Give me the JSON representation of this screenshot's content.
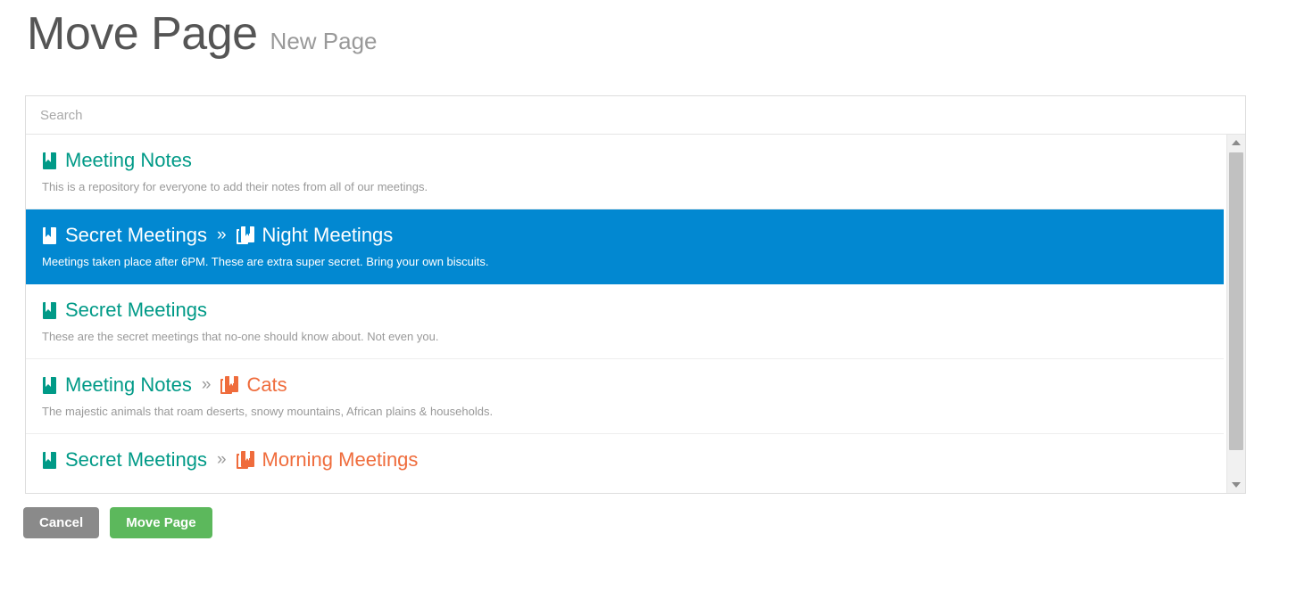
{
  "header": {
    "title": "Move Page",
    "subtitle": "New Page"
  },
  "search": {
    "placeholder": "Search",
    "value": ""
  },
  "results": [
    {
      "crumbs": [
        {
          "icon": "book-icon",
          "label": "Meeting Notes",
          "kind": "book"
        }
      ],
      "description": "This is a repository for everyone to add their notes from all of our meetings.",
      "selected": false
    },
    {
      "crumbs": [
        {
          "icon": "book-icon",
          "label": "Secret Meetings",
          "kind": "book"
        },
        {
          "icon": "page-icon",
          "label": "Night Meetings",
          "kind": "page"
        }
      ],
      "description": "Meetings taken place after 6PM. These are extra super secret. Bring your own biscuits.",
      "selected": true
    },
    {
      "crumbs": [
        {
          "icon": "book-icon",
          "label": "Secret Meetings",
          "kind": "book"
        }
      ],
      "description": "These are the secret meetings that no-one should know about. Not even you.",
      "selected": false
    },
    {
      "crumbs": [
        {
          "icon": "book-icon",
          "label": "Meeting Notes",
          "kind": "book"
        },
        {
          "icon": "page-icon",
          "label": "Cats",
          "kind": "page"
        }
      ],
      "description": "The majestic animals that roam deserts, snowy mountains, African plains & households.",
      "selected": false
    },
    {
      "crumbs": [
        {
          "icon": "book-icon",
          "label": "Secret Meetings",
          "kind": "book"
        },
        {
          "icon": "page-icon",
          "label": "Morning Meetings",
          "kind": "page"
        }
      ],
      "description": "",
      "selected": false
    }
  ],
  "breadcrumb_separator": "»",
  "scrollbar": {
    "up_arrow": "scroll-up-arrow",
    "down_arrow": "scroll-down-arrow"
  },
  "actions": {
    "cancel_label": "Cancel",
    "submit_label": "Move Page"
  },
  "colors": {
    "selected_row": "#0288d1",
    "book_accent": "#009a87",
    "page_accent": "#ef6c3c",
    "primary_button": "#5cb85c",
    "cancel_button": "#8a8a8a",
    "title_text": "#555555",
    "subtitle_text": "#999999",
    "description_text": "#999999"
  }
}
